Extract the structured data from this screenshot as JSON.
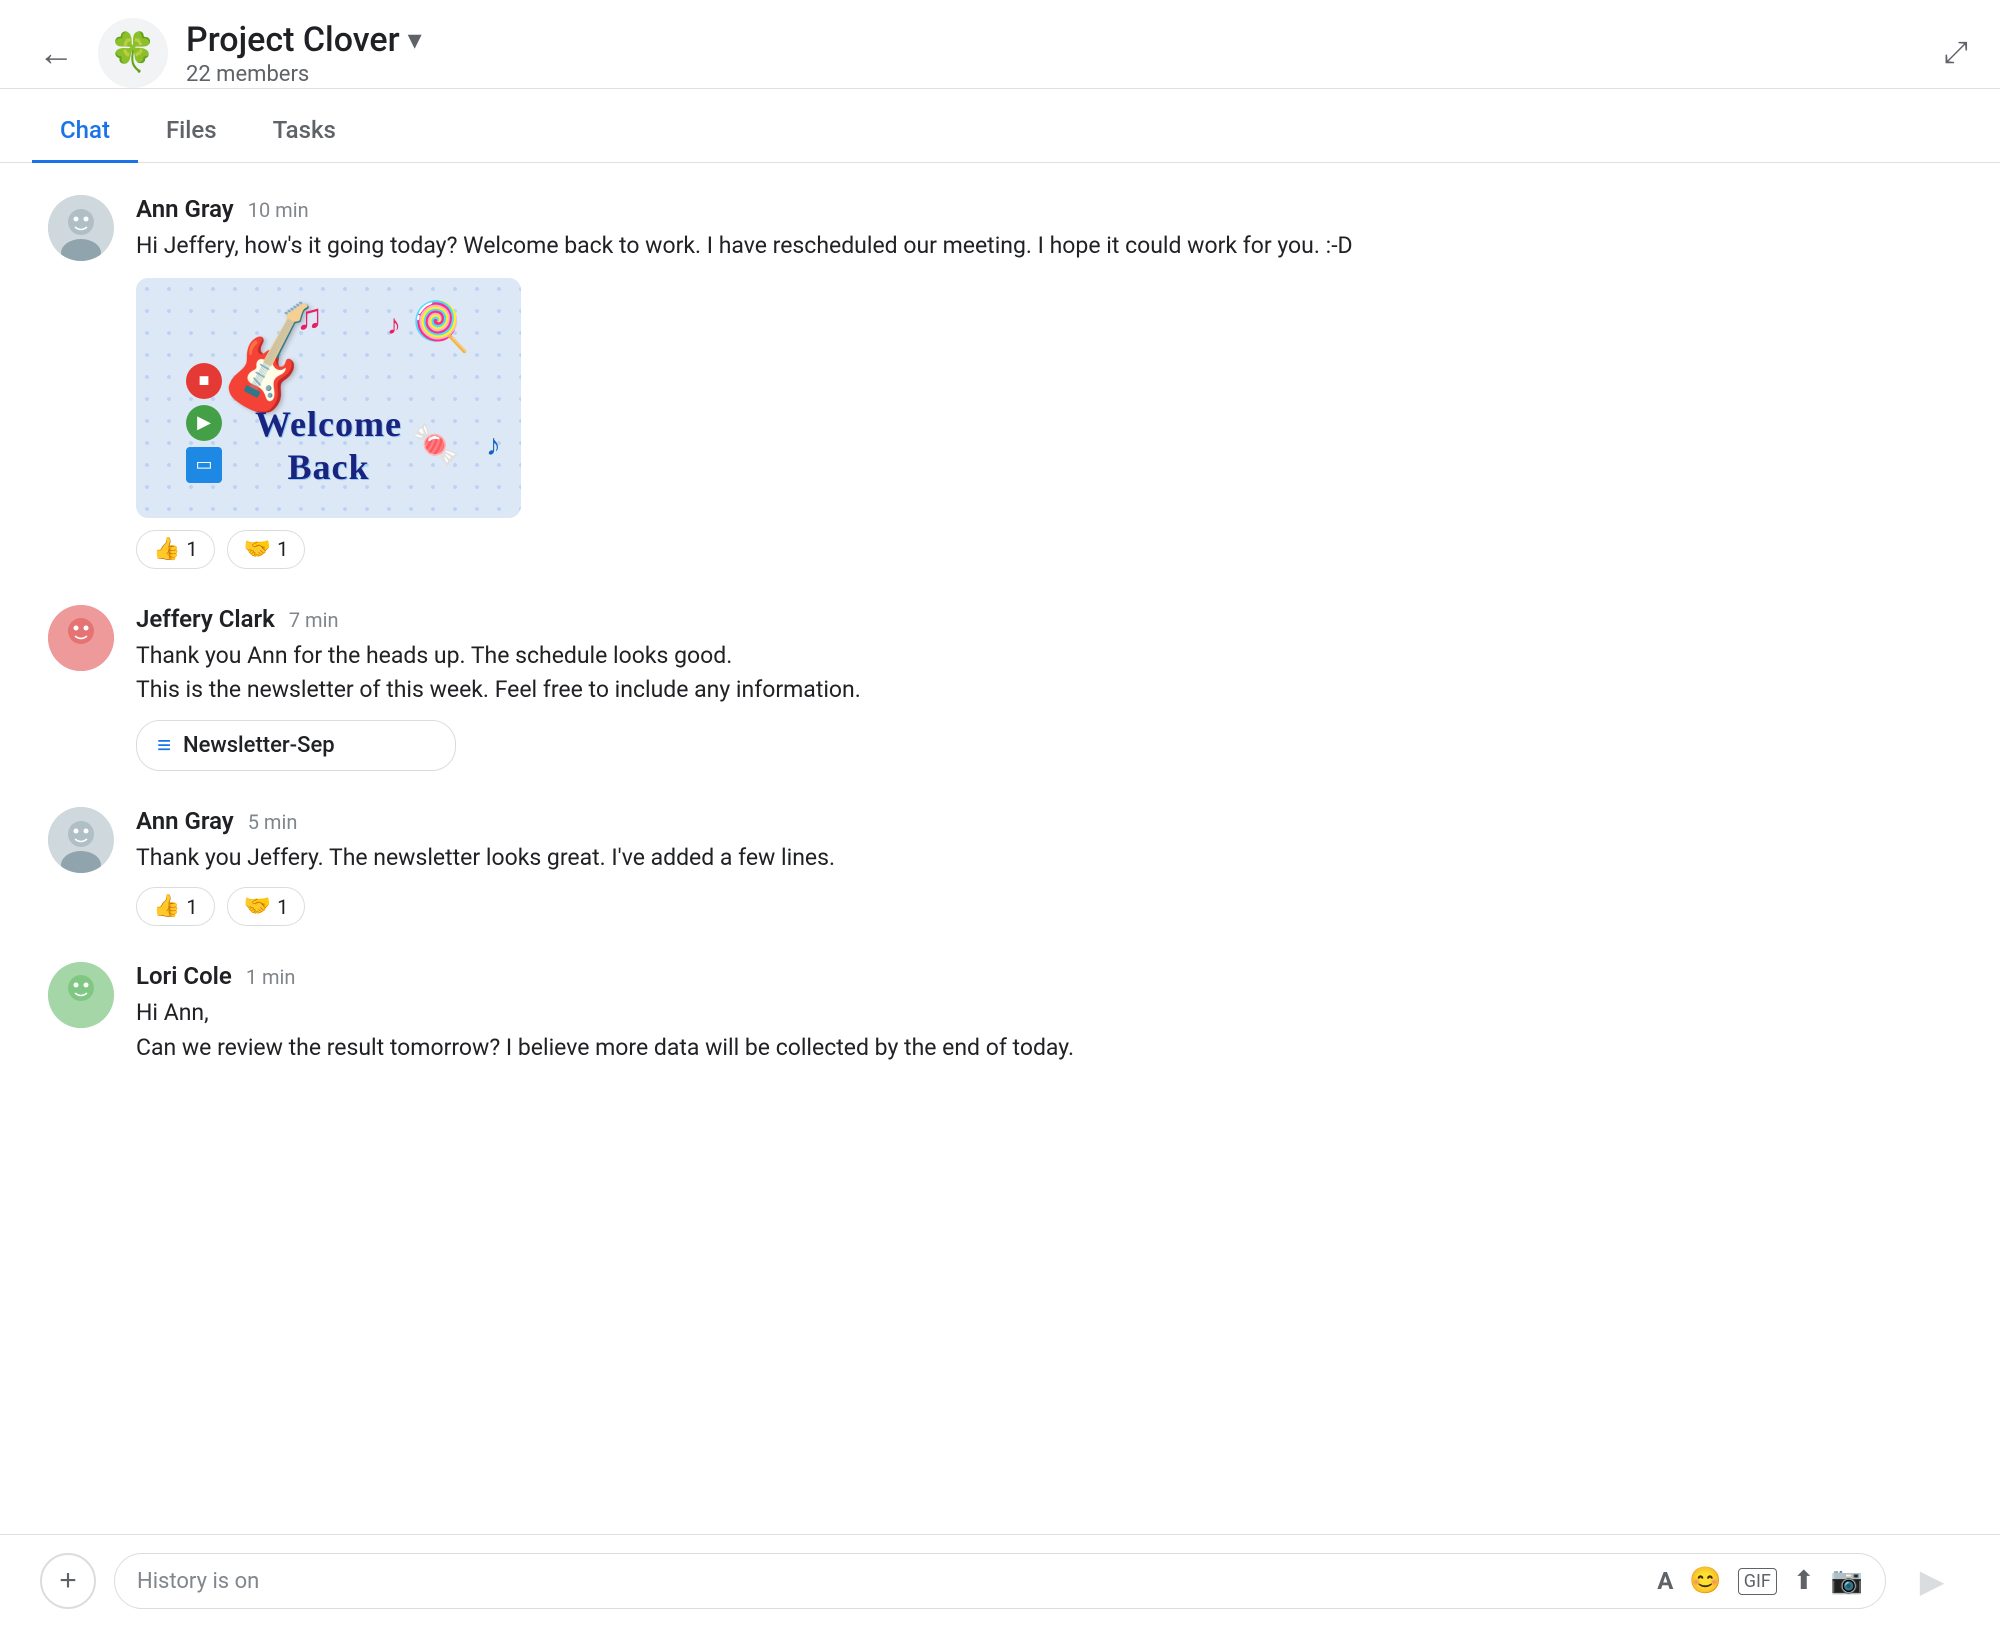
{
  "header": {
    "back_label": "←",
    "project_icon": "🍀",
    "project_name": "Project Clover",
    "dropdown_icon": "▾",
    "members_label": "22 members",
    "expand_icon": "⤢"
  },
  "tabs": [
    {
      "id": "chat",
      "label": "Chat",
      "active": true
    },
    {
      "id": "files",
      "label": "Files",
      "active": false
    },
    {
      "id": "tasks",
      "label": "Tasks",
      "active": false
    }
  ],
  "messages": [
    {
      "id": "msg1",
      "sender": "Ann Gray",
      "time": "10 min",
      "text": "Hi Jeffery, how's it going today? Welcome back to work. I have rescheduled our meeting. I hope it could work for you. :-D",
      "has_sticker": true,
      "sticker_text": "Welcome\nBack",
      "reactions": [
        {
          "emoji": "👍",
          "count": "1"
        },
        {
          "emoji": "🤝",
          "count": "1"
        }
      ],
      "avatar_type": "ann"
    },
    {
      "id": "msg2",
      "sender": "Jeffery Clark",
      "time": "7 min",
      "text": "Thank you Ann for the heads up. The schedule looks good.\nThis is the newsletter of this week. Feel free to include any information.",
      "has_file": true,
      "file_name": "Newsletter-Sep",
      "reactions": [],
      "avatar_type": "jeffery"
    },
    {
      "id": "msg3",
      "sender": "Ann Gray",
      "time": "5 min",
      "text": "Thank you Jeffery. The newsletter looks great. I've added a few lines.",
      "reactions": [
        {
          "emoji": "👍",
          "count": "1"
        },
        {
          "emoji": "🤝",
          "count": "1"
        }
      ],
      "avatar_type": "ann"
    },
    {
      "id": "msg4",
      "sender": "Lori Cole",
      "time": "1 min",
      "text": "Hi Ann,\nCan we review the result tomorrow? I believe more data will be collected by the end of today.",
      "reactions": [],
      "avatar_type": "lori"
    }
  ],
  "input": {
    "placeholder": "History is on"
  },
  "toolbar": {
    "add_label": "+",
    "format_label": "A",
    "emoji_label": "😊",
    "gif_label": "GIF",
    "upload_label": "⬆",
    "video_label": "📷",
    "send_label": "▶"
  }
}
